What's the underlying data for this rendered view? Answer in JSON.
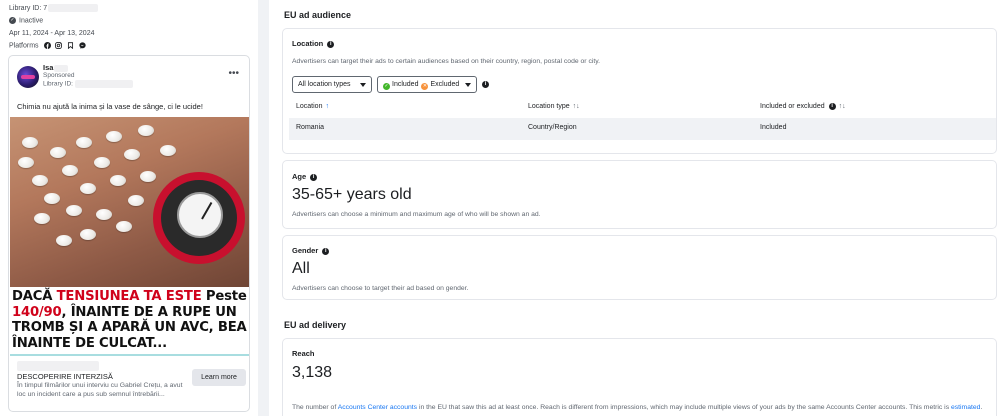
{
  "left": {
    "library_id_label": "Library ID: 7",
    "status": "Inactive",
    "date_range": "Apr 11, 2024 - Apr 13, 2024",
    "platforms_label": "Platforms",
    "platform_icons": [
      "facebook-icon",
      "instagram-icon",
      "messenger-icon",
      "audience-network-icon"
    ],
    "card": {
      "advertiser_name": "Isa",
      "sponsored": "Sponsored",
      "library_id_label": "Library ID:",
      "menu_glyph": "•••",
      "ad_text": "Chimia nu ajută la inima și la vase de sânge, ci le ucide!",
      "headline_parts": [
        "DACĂ ",
        "TENSIUNEA TA ESTE",
        " Peste ",
        "140/90",
        ", ÎNAINTE DE A RUPE UN TROMB ȘI A APARĂ UN AVC, BEA ÎNAINTE DE CULCAT..."
      ],
      "cta_title": "DESCOPERIRE INTERZISĂ",
      "cta_desc": "În timpul filmărilor unui interviu cu Gabriel Crețu, a avut loc un incident care a pus sub semnul întrebării...",
      "cta_button": "Learn more"
    }
  },
  "audience": {
    "section_title": "EU ad audience",
    "location": {
      "title": "Location",
      "desc": "Advertisers can target their ads to certain audiences based on their country, region, postal code or city.",
      "filter_label": "All location types",
      "included_label": "Included",
      "excluded_label": "Excluded",
      "columns": [
        "Location",
        "Location type",
        "Included or excluded"
      ],
      "rows": [
        {
          "location": "Romania",
          "type": "Country/Region",
          "status": "Included"
        }
      ]
    },
    "age": {
      "title": "Age",
      "value": "35-65+ years old",
      "desc": "Advertisers can choose a minimum and maximum age of who will be shown an ad."
    },
    "gender": {
      "title": "Gender",
      "value": "All",
      "desc": "Advertisers can choose to target their ad based on gender."
    }
  },
  "delivery": {
    "section_title": "EU ad delivery",
    "reach": {
      "title": "Reach",
      "value": "3,138",
      "desc_before": "The number of ",
      "desc_link": "Accounts Center accounts",
      "desc_after": " in the EU that saw this ad at least once. Reach is different from impressions, which may include multiple views of your ads by the same Accounts Center accounts. This metric is ",
      "desc_link2": "estimated",
      "desc_end": "."
    }
  },
  "colors": {
    "accent": "#1877f2",
    "headline_red": "#d0021b",
    "included_green": "#42b72a",
    "excluded_orange": "#f7923b",
    "background": "#f0f2f5"
  }
}
